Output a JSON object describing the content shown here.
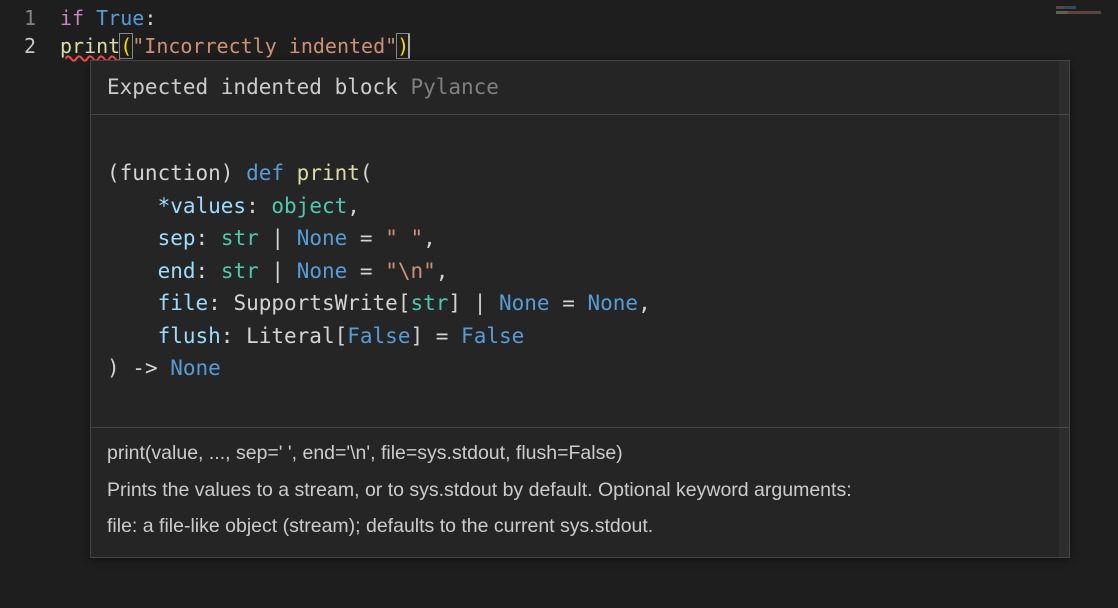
{
  "editor": {
    "lines": [
      {
        "number": "1",
        "tokens": [
          "if",
          " ",
          "True",
          ":"
        ]
      },
      {
        "number": "2",
        "tokens": [
          "print",
          "(",
          "\"Incorrectly indented\"",
          ")"
        ]
      }
    ],
    "active_line": 2,
    "error_underline_text": "print"
  },
  "hover": {
    "error": {
      "message": "Expected indented block",
      "source": "Pylance"
    },
    "signature": {
      "prefix": "(function) ",
      "def": "def",
      "name": "print",
      "open": "(",
      "params": [
        {
          "text": "*values",
          "type": "object",
          "trail": ","
        },
        {
          "text": "sep",
          "type": "str | None",
          "default": "\" \"",
          "trail": ","
        },
        {
          "text": "end",
          "type": "str | None",
          "default": "\"\\n\"",
          "trail": ","
        },
        {
          "text": "file",
          "type": "SupportsWrite[str] | None",
          "default": "None",
          "trail": ","
        },
        {
          "text": "flush",
          "type": "Literal[False]",
          "default": "False",
          "trail": ""
        }
      ],
      "close": ")",
      "ret": "None"
    },
    "doc": {
      "usage": "print(value, ..., sep=' ', end='\\n', file=sys.stdout, flush=False)",
      "desc": "Prints the values to a stream, or to sys.stdout by default. Optional keyword arguments:",
      "file_line": "file: a file-like object (stream); defaults to the current sys.stdout."
    }
  }
}
